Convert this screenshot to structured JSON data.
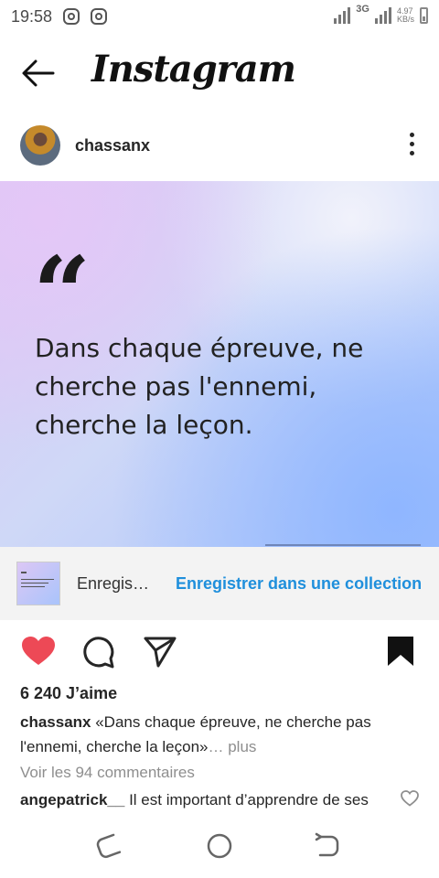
{
  "status_bar": {
    "time": "19:58",
    "network": "3G",
    "speed_value": "4.97",
    "speed_unit": "KB/s"
  },
  "header": {
    "logo_text": "Instagram"
  },
  "post": {
    "username": "chassanx",
    "image": {
      "quote_mark": "“",
      "quote_text": "Dans chaque épreuve, ne\ncherche pas l'ennemi,\ncherche la leçon."
    },
    "save_banner": {
      "label": "Enregis…",
      "collection_link": "Enregistrer dans une collection"
    },
    "likes": "6 240 J’aime",
    "caption": {
      "username": "chassanx",
      "text": " «Dans chaque épreuve, ne cherche pas l'ennemi, cherche la leçon»",
      "more": "… plus"
    },
    "view_comments": "Voir les 94 commentaires",
    "comment": {
      "username": "angepatrick__",
      "text": " Il est important d’apprendre de ses"
    }
  },
  "colors": {
    "like_red": "#ed4956",
    "link_blue": "#1f8fdc"
  }
}
